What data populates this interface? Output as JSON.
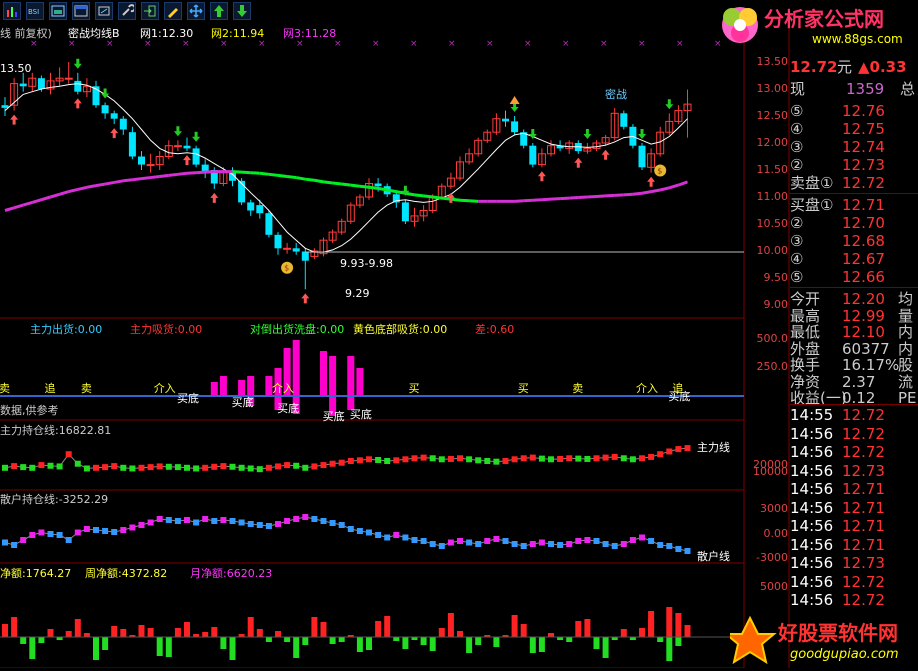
{
  "toolbar": {
    "items": [
      "bar-chart-icon",
      "bsi-icon",
      "picture-icon",
      "window-icon",
      "link-icon",
      "enter-icon",
      "pencil-icon",
      "move-icon",
      "up-arrow-icon",
      "down-arrow-icon"
    ]
  },
  "logos": {
    "top": {
      "text": "分析家公式网",
      "url": "www.88gs.com"
    },
    "bottom": {
      "text": "好股票软件网",
      "url": "goodgupiao.com"
    }
  },
  "main_chart": {
    "header": {
      "prefix": "线 前复权)",
      "name": "密战均线B",
      "ma1": "网1:12.30",
      "ma2": "网2:11.94",
      "ma3": "网3:11.28"
    },
    "top_left_price": "13.50",
    "annotations": {
      "range": "9.93-9.98",
      "low": "9.29",
      "mizhan": "密战"
    },
    "y_ticks": [
      "13.50",
      "13.00",
      "12.50",
      "12.00",
      "11.50",
      "11.00",
      "10.50",
      "10.00",
      "9.50",
      "9.00"
    ]
  },
  "sub1": {
    "header": {
      "a": "主力出货:0.00",
      "b": "主力吸货:0.00",
      "c": "对倒出货洗盘:0.00",
      "d": "黄色底部吸货:0.00",
      "e": "差:0.60"
    },
    "note": "数据,供参考",
    "y_ticks": [
      "500.0",
      "250.0"
    ],
    "labels": {
      "maidi": "买底",
      "jieru": "介入",
      "mai": "买",
      "mai4": "卖",
      "zhui": "追"
    }
  },
  "sub2": {
    "header": "主力持仓线:16822.81",
    "line_label": "主力线",
    "y_ticks": [
      "20000",
      "10000"
    ]
  },
  "sub3": {
    "header": "散户持仓线:-3252.29",
    "line_label": "散户线",
    "y_ticks": [
      "3000",
      "0.00",
      "-3000"
    ]
  },
  "sub4": {
    "header": {
      "a": "净额:1764.27",
      "b": "周净额:4372.82",
      "c": "月净额:6620.23"
    },
    "y_ticks": [
      "5000"
    ]
  },
  "right_panel": {
    "price": "12.72",
    "price_unit": "元",
    "change": "▲0.33",
    "now_label": "现",
    "now_value": "1359",
    "total_label": "总",
    "sell": [
      {
        "label": "⑤",
        "price": "12.76"
      },
      {
        "label": "④",
        "price": "12.75"
      },
      {
        "label": "③",
        "price": "12.74"
      },
      {
        "label": "②",
        "price": "12.73"
      },
      {
        "label": "卖盘①",
        "price": "12.72"
      }
    ],
    "buy": [
      {
        "label": "买盘①",
        "price": "12.71"
      },
      {
        "label": "②",
        "price": "12.70"
      },
      {
        "label": "③",
        "price": "12.68"
      },
      {
        "label": "④",
        "price": "12.67"
      },
      {
        "label": "⑤",
        "price": "12.66"
      }
    ],
    "stats": [
      {
        "label": "今开",
        "value": "12.20",
        "extra": "均"
      },
      {
        "label": "最高",
        "value": "12.99",
        "extra": "量"
      },
      {
        "label": "最低",
        "value": "12.10",
        "extra": "内"
      },
      {
        "label": "外盘",
        "value": "60377",
        "extra": "内"
      },
      {
        "label": "换手",
        "value": "16.17%",
        "extra": "股"
      },
      {
        "label": "净资",
        "value": "2.37",
        "extra": "流"
      },
      {
        "label": "收益(一)",
        "value": "0.12",
        "extra": "PE"
      }
    ],
    "ticks": [
      {
        "time": "14:55",
        "price": "12.72"
      },
      {
        "time": "14:56",
        "price": "12.72"
      },
      {
        "time": "14:56",
        "price": "12.72"
      },
      {
        "time": "14:56",
        "price": "12.73"
      },
      {
        "time": "14:56",
        "price": "12.71"
      },
      {
        "time": "14:56",
        "price": "12.71"
      },
      {
        "time": "14:56",
        "price": "12.71"
      },
      {
        "time": "14:56",
        "price": "12.71"
      },
      {
        "time": "14:56",
        "price": "12.73"
      },
      {
        "time": "14:56",
        "price": "12.72"
      },
      {
        "time": "14:56",
        "price": "12.72"
      }
    ]
  },
  "colors": {
    "up": "#ff3c3c",
    "down": "#00e5ff",
    "ma_slow_up": "#00ee22",
    "ma_slow_down": "#d52fd5",
    "ma_fast": "#ffffff",
    "text_yellow": "#ffff00",
    "text_red": "#ff3333"
  },
  "candles": {
    "o": [
      12.7,
      12.7,
      13.1,
      13.05,
      13.2,
      13.0,
      13.15,
      13.2,
      13.15,
      12.95,
      13.05,
      12.7,
      12.55,
      12.45,
      12.2,
      11.75,
      11.6,
      11.6,
      11.75,
      11.95,
      11.95,
      11.9,
      11.6,
      11.5,
      11.25,
      11.45,
      11.3,
      10.9,
      10.85,
      10.7,
      10.3,
      10.05,
      10.05,
      9.99,
      9.9,
      9.95,
      10.2,
      10.35,
      10.55,
      10.85,
      11.0,
      11.25,
      11.2,
      11.05,
      10.9,
      10.55,
      10.65,
      10.75,
      11.0,
      11.2,
      11.35,
      11.65,
      11.8,
      12.05,
      12.2,
      12.45,
      12.4,
      12.2,
      11.95,
      11.6,
      11.8,
      11.95,
      11.9,
      12.0,
      11.85,
      11.9,
      12.0,
      12.1,
      12.55,
      12.3,
      11.95,
      11.55,
      11.8,
      12.2,
      12.4,
      12.6
    ],
    "c": [
      12.65,
      13.1,
      13.05,
      13.2,
      13.0,
      13.15,
      13.2,
      13.2,
      12.95,
      13.05,
      12.7,
      12.55,
      12.45,
      12.25,
      11.75,
      11.6,
      11.6,
      11.75,
      11.95,
      11.95,
      11.9,
      11.6,
      11.45,
      11.25,
      11.45,
      11.3,
      10.9,
      10.75,
      10.7,
      10.3,
      10.05,
      10.05,
      9.99,
      9.82,
      10.0,
      10.2,
      10.35,
      10.55,
      10.85,
      11.0,
      11.25,
      11.2,
      11.05,
      10.9,
      10.55,
      10.65,
      10.75,
      11.0,
      11.2,
      11.35,
      11.65,
      11.8,
      12.05,
      12.2,
      12.45,
      12.4,
      12.2,
      11.95,
      11.6,
      11.8,
      11.95,
      11.9,
      12.0,
      11.85,
      11.9,
      12.0,
      12.1,
      12.55,
      12.3,
      11.95,
      11.55,
      11.8,
      12.2,
      12.4,
      12.6,
      12.72
    ],
    "h": [
      12.85,
      13.2,
      13.3,
      13.3,
      13.25,
      13.3,
      13.4,
      13.5,
      13.3,
      13.2,
      13.15,
      12.75,
      12.6,
      12.5,
      12.3,
      11.85,
      11.8,
      11.85,
      12.05,
      12.05,
      12.1,
      11.95,
      11.7,
      11.55,
      11.55,
      11.55,
      11.35,
      10.95,
      10.95,
      10.75,
      10.35,
      10.15,
      10.15,
      10.05,
      10.05,
      10.25,
      10.4,
      10.6,
      10.9,
      11.05,
      11.35,
      11.35,
      11.25,
      11.1,
      10.95,
      10.8,
      10.85,
      11.05,
      11.25,
      11.45,
      11.75,
      11.9,
      12.1,
      12.25,
      12.55,
      12.6,
      12.5,
      12.25,
      12.0,
      11.9,
      12.05,
      12.05,
      12.05,
      12.05,
      12.0,
      12.05,
      12.15,
      12.65,
      12.6,
      12.35,
      12.0,
      11.9,
      12.3,
      12.55,
      12.7,
      12.99
    ],
    "l": [
      12.5,
      12.6,
      12.95,
      12.95,
      12.95,
      12.9,
      13.05,
      13.1,
      12.9,
      12.85,
      12.65,
      12.45,
      12.35,
      12.15,
      11.7,
      11.5,
      11.45,
      11.5,
      11.7,
      11.85,
      11.85,
      11.55,
      11.35,
      11.15,
      11.2,
      11.2,
      10.85,
      10.65,
      10.6,
      10.25,
      9.93,
      9.95,
      9.93,
      9.29,
      9.85,
      9.9,
      10.15,
      10.3,
      10.5,
      10.8,
      10.95,
      11.1,
      11.0,
      10.8,
      10.5,
      10.45,
      10.55,
      10.7,
      10.95,
      11.15,
      11.3,
      11.6,
      11.75,
      12.0,
      12.15,
      12.3,
      12.15,
      11.9,
      11.55,
      11.55,
      11.75,
      11.85,
      11.8,
      11.8,
      11.8,
      11.85,
      11.95,
      12.05,
      12.25,
      11.9,
      11.5,
      11.45,
      11.75,
      12.15,
      12.35,
      12.1
    ]
  },
  "ma_fast": [
    12.6,
    12.75,
    12.9,
    12.95,
    13.0,
    13.03,
    13.05,
    13.08,
    13.1,
    13.07,
    13.0,
    12.9,
    12.78,
    12.62,
    12.45,
    12.25,
    12.05,
    11.9,
    11.82,
    11.8,
    11.82,
    11.8,
    11.72,
    11.62,
    11.52,
    11.42,
    11.25,
    11.08,
    10.92,
    10.75,
    10.55,
    10.35,
    10.2,
    10.05,
    9.98,
    9.98,
    10.02,
    10.1,
    10.22,
    10.38,
    10.55,
    10.72,
    10.85,
    10.93,
    10.95,
    10.92,
    10.9,
    10.92,
    10.98,
    11.05,
    11.18,
    11.35,
    11.52,
    11.7,
    11.88,
    12.05,
    12.15,
    12.18,
    12.12,
    12.05,
    11.98,
    11.95,
    11.93,
    11.93,
    11.92,
    11.93,
    11.96,
    12.02,
    12.1,
    12.12,
    12.05,
    11.98,
    12.02,
    12.12,
    12.28,
    12.45
  ],
  "ma_slow": [
    10.75,
    10.8,
    10.85,
    10.9,
    10.95,
    11.0,
    11.05,
    11.1,
    11.14,
    11.18,
    11.21,
    11.24,
    11.27,
    11.3,
    11.32,
    11.34,
    11.36,
    11.38,
    11.4,
    11.42,
    11.44,
    11.45,
    11.46,
    11.47,
    11.47,
    11.47,
    11.46,
    11.45,
    11.44,
    11.42,
    11.4,
    11.38,
    11.36,
    11.33,
    11.31,
    11.28,
    11.26,
    11.24,
    11.22,
    11.2,
    11.18,
    11.16,
    11.13,
    11.1,
    11.07,
    11.04,
    11.02,
    11.0,
    10.98,
    10.96,
    10.94,
    10.93,
    10.92,
    10.92,
    10.92,
    10.92,
    10.92,
    10.93,
    10.94,
    10.95,
    10.96,
    10.97,
    10.98,
    10.99,
    11.0,
    11.01,
    11.02,
    11.03,
    11.04,
    11.05,
    11.07,
    11.1,
    11.13,
    11.17,
    11.22,
    11.28
  ]
}
